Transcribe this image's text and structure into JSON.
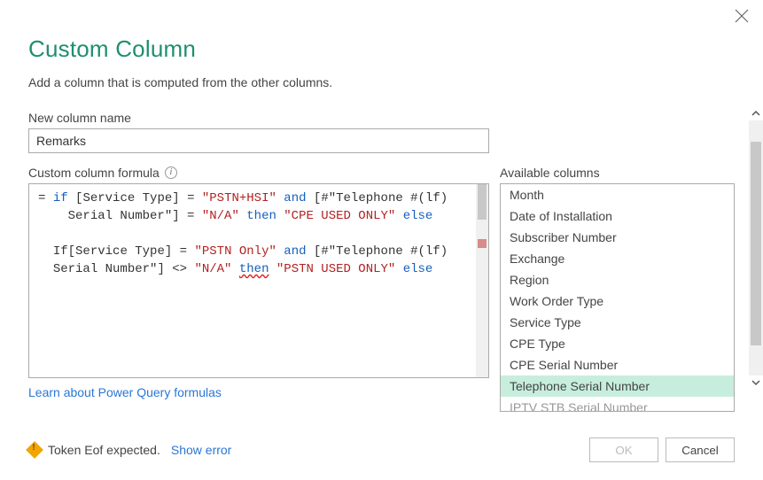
{
  "dialog": {
    "title": "Custom Column",
    "subtitle": "Add a column that is computed from the other columns.",
    "close_icon": "close"
  },
  "nameField": {
    "label": "New column name",
    "value": "Remarks"
  },
  "formulaField": {
    "label": "Custom column formula",
    "tokens_line1": {
      "eq": "= ",
      "if": "if",
      "sp1": " [",
      "col1": "Service Type",
      "rb1": "] = ",
      "str1": "\"PSTN+HSI\"",
      "sp2": " ",
      "and": "and",
      "sp3": " [",
      "col2a": "#\"Telephone #(lf)"
    },
    "tokens_line2": {
      "indent": "    ",
      "col2b": "Serial Number\"",
      "rb": "] = ",
      "str2": "\"N/A\"",
      "sp": " ",
      "then": "then",
      "sp2": " ",
      "str3": "\"CPE USED ONLY\"",
      "sp3": " ",
      "else": "else"
    },
    "tokens_line4": {
      "indent": "  ",
      "If": "If",
      "lb": "[",
      "col1": "Service Type",
      "rb": "] = ",
      "str1": "\"PSTN Only\"",
      "sp": " ",
      "and": "and",
      "sp2": " [",
      "col2a": "#\"Telephone #(lf)"
    },
    "tokens_line5": {
      "indent": "  ",
      "col2b": "Serial Number\"",
      "rb": "] <> ",
      "str2": "\"N/A\"",
      "sp": " ",
      "then": "then",
      "sp2": " ",
      "str3": "\"PSTN USED ONLY\"",
      "sp3": " ",
      "else": "else"
    }
  },
  "learn_link": "Learn about Power Query formulas",
  "availableColumns": {
    "label": "Available columns",
    "items": [
      "Month",
      "Date of Installation",
      "Subscriber Number",
      "Exchange",
      "Region",
      "Work Order Type",
      "Service Type",
      "CPE Type",
      "CPE Serial Number",
      "Telephone Serial Number",
      "IPTV STB Serial Number"
    ],
    "selected_index": 9
  },
  "footer": {
    "warning": "Token Eof expected.",
    "show_error": "Show error",
    "ok": "OK",
    "cancel": "Cancel"
  }
}
